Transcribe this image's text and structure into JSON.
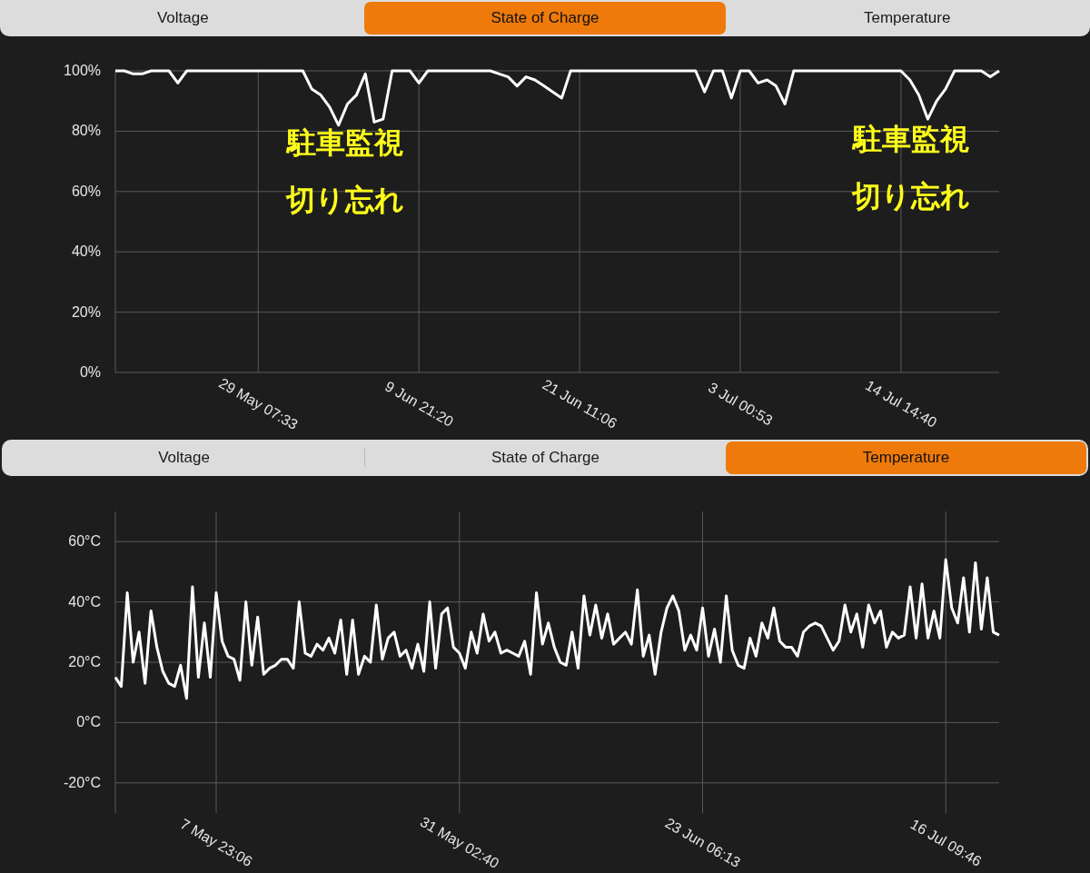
{
  "panels": [
    {
      "tabs": [
        {
          "label": "Voltage",
          "selected": false
        },
        {
          "label": "State of Charge",
          "selected": true
        },
        {
          "label": "Temperature",
          "selected": false
        }
      ],
      "chart_data": {
        "type": "line",
        "grid": true,
        "ylim": [
          0,
          100
        ],
        "categories": [
          null,
          null,
          null,
          null,
          null,
          null,
          null,
          null,
          null,
          null,
          null,
          null,
          null,
          null,
          null,
          null,
          "29 May 07:33",
          null,
          null,
          null,
          null,
          null,
          null,
          null,
          null,
          null,
          null,
          null,
          null,
          null,
          null,
          null,
          null,
          null,
          "9 Jun 21:20",
          null,
          null,
          null,
          null,
          null,
          null,
          null,
          null,
          null,
          null,
          null,
          null,
          null,
          null,
          null,
          null,
          null,
          "21 Jun 11:06",
          null,
          null,
          null,
          null,
          null,
          null,
          null,
          null,
          null,
          null,
          null,
          null,
          null,
          null,
          null,
          null,
          null,
          "3 Jul 00:53",
          null,
          null,
          null,
          null,
          null,
          null,
          null,
          null,
          null,
          null,
          null,
          null,
          null,
          null,
          null,
          null,
          null,
          "14 Jul 14:40",
          null,
          null,
          null,
          null,
          null,
          null,
          null,
          null,
          null,
          null,
          null
        ],
        "yticks": [
          {
            "value": 0,
            "label": "0%"
          },
          {
            "value": 20,
            "label": "20%"
          },
          {
            "value": 40,
            "label": "40%"
          },
          {
            "value": 60,
            "label": "60%"
          },
          {
            "value": 80,
            "label": "80%"
          },
          {
            "value": 100,
            "label": "100%"
          }
        ],
        "series": [
          {
            "color": "#ffffff",
            "values": [
              100,
              100,
              99,
              99,
              100,
              100,
              100,
              96,
              100,
              100,
              100,
              100,
              100,
              100,
              100,
              100,
              100,
              100,
              100,
              100,
              100,
              100,
              94,
              92,
              88,
              82,
              89,
              92,
              99,
              83,
              84,
              100,
              100,
              100,
              96,
              100,
              100,
              100,
              100,
              100,
              100,
              100,
              100,
              99,
              98,
              95,
              98,
              97,
              95,
              93,
              91,
              100,
              100,
              100,
              100,
              100,
              100,
              100,
              100,
              100,
              100,
              100,
              100,
              100,
              100,
              100,
              93,
              100,
              100,
              91,
              100,
              100,
              96,
              97,
              95,
              89,
              100,
              100,
              100,
              100,
              100,
              100,
              100,
              100,
              100,
              100,
              100,
              100,
              100,
              97,
              92,
              84,
              90,
              94,
              100,
              100,
              100,
              100,
              98,
              100
            ]
          }
        ],
        "annotations": [
          {
            "text": "駐車監視"
          },
          {
            "text": "切り忘れ"
          },
          {
            "text": "駐車監視"
          },
          {
            "text": "切り忘れ"
          }
        ]
      }
    },
    {
      "tabs": [
        {
          "label": "Voltage",
          "selected": false
        },
        {
          "label": "State of Charge",
          "selected": false
        },
        {
          "label": "Temperature",
          "selected": true
        }
      ],
      "chart_data": {
        "type": "line",
        "grid": true,
        "ylim": [
          -30,
          70
        ],
        "categories": [
          null,
          null,
          null,
          null,
          null,
          null,
          null,
          null,
          null,
          null,
          null,
          null,
          null,
          null,
          null,
          null,
          null,
          "7 May 23:06",
          null,
          null,
          null,
          null,
          null,
          null,
          null,
          null,
          null,
          null,
          null,
          null,
          null,
          null,
          null,
          null,
          null,
          null,
          null,
          null,
          null,
          null,
          null,
          null,
          null,
          null,
          null,
          null,
          null,
          null,
          null,
          null,
          null,
          null,
          null,
          null,
          null,
          null,
          null,
          null,
          "31 May 02:40",
          null,
          null,
          null,
          null,
          null,
          null,
          null,
          null,
          null,
          null,
          null,
          null,
          null,
          null,
          null,
          null,
          null,
          null,
          null,
          null,
          null,
          null,
          null,
          null,
          null,
          null,
          null,
          null,
          null,
          null,
          null,
          null,
          null,
          null,
          null,
          null,
          null,
          null,
          null,
          null,
          "23 Jun 06:13",
          null,
          null,
          null,
          null,
          null,
          null,
          null,
          null,
          null,
          null,
          null,
          null,
          null,
          null,
          null,
          null,
          null,
          null,
          null,
          null,
          null,
          null,
          null,
          null,
          null,
          null,
          null,
          null,
          null,
          null,
          null,
          null,
          null,
          null,
          null,
          null,
          null,
          null,
          null,
          null,
          "16 Jul 09:46",
          null,
          null,
          null,
          null,
          null,
          null,
          null,
          null,
          null
        ],
        "yticks": [
          {
            "value": -20,
            "label": "-20°C"
          },
          {
            "value": 0,
            "label": "0°C"
          },
          {
            "value": 20,
            "label": "20°C"
          },
          {
            "value": 40,
            "label": "40°C"
          },
          {
            "value": 60,
            "label": "60°C"
          }
        ],
        "series": [
          {
            "color": "#ffffff",
            "values": [
              15,
              12,
              43,
              20,
              30,
              13,
              37,
              25,
              17,
              13,
              12,
              19,
              8,
              45,
              15,
              33,
              15,
              43,
              27,
              22,
              21,
              14,
              40,
              19,
              35,
              16,
              18,
              19,
              21,
              21,
              18,
              40,
              23,
              22,
              26,
              24,
              28,
              23,
              34,
              16,
              34,
              16,
              22,
              20,
              39,
              21,
              28,
              30,
              22,
              24,
              18,
              26,
              17,
              40,
              18,
              36,
              38,
              25,
              23,
              18,
              30,
              23,
              36,
              27,
              30,
              23,
              24,
              23,
              22,
              27,
              16,
              43,
              26,
              33,
              25,
              20,
              19,
              30,
              18,
              42,
              29,
              39,
              28,
              36,
              26,
              28,
              30,
              26,
              44,
              22,
              29,
              16,
              30,
              38,
              42,
              37,
              24,
              29,
              24,
              38,
              22,
              31,
              20,
              42,
              24,
              19,
              18,
              28,
              22,
              33,
              28,
              38,
              27,
              25,
              25,
              22,
              30,
              32,
              33,
              32,
              28,
              24,
              27,
              39,
              30,
              36,
              25,
              39,
              33,
              37,
              25,
              30,
              28,
              29,
              45,
              28,
              46,
              28,
              37,
              28,
              54,
              38,
              33,
              48,
              30,
              53,
              31,
              48,
              30,
              29
            ]
          }
        ]
      }
    }
  ]
}
